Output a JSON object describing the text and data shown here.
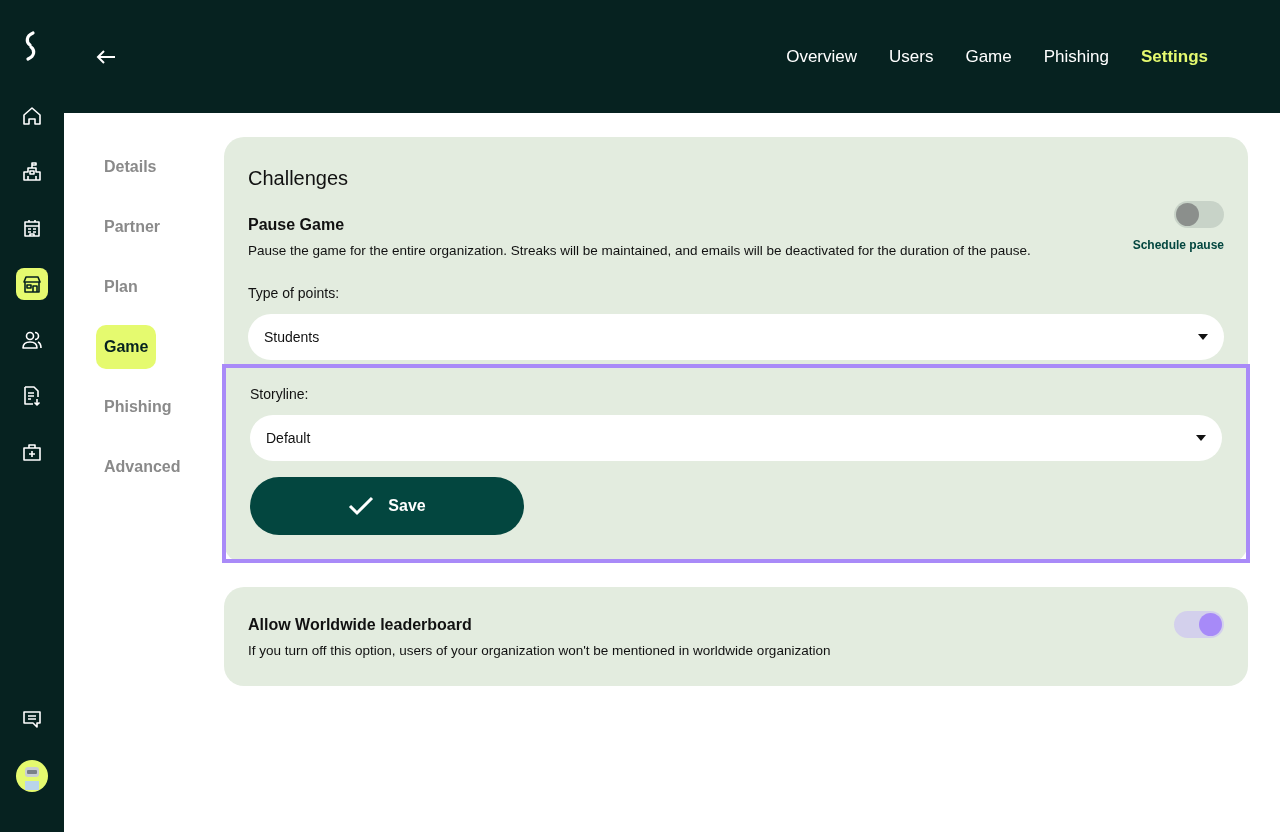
{
  "rail": {
    "items": [
      {
        "kind": "home",
        "selected": false
      },
      {
        "kind": "school",
        "selected": false
      },
      {
        "kind": "building",
        "selected": false
      },
      {
        "kind": "store",
        "selected": true
      },
      {
        "kind": "users",
        "selected": false
      },
      {
        "kind": "report",
        "selected": false
      },
      {
        "kind": "medkit",
        "selected": false
      }
    ],
    "bottom": [
      {
        "kind": "chat"
      },
      {
        "kind": "avatar"
      }
    ]
  },
  "top_nav": {
    "tabs": [
      {
        "label": "Overview",
        "selected": false
      },
      {
        "label": "Users",
        "selected": false
      },
      {
        "label": "Game",
        "selected": false
      },
      {
        "label": "Phishing",
        "selected": false
      },
      {
        "label": "Settings",
        "selected": true
      }
    ]
  },
  "settings_menu": {
    "items": [
      {
        "label": "Details",
        "selected": false
      },
      {
        "label": "Partner",
        "selected": false
      },
      {
        "label": "Plan",
        "selected": false
      },
      {
        "label": "Game",
        "selected": true
      },
      {
        "label": "Phishing",
        "selected": false
      },
      {
        "label": "Advanced",
        "selected": false
      }
    ]
  },
  "challenges": {
    "title": "Challenges",
    "pause_game": {
      "title": "Pause Game",
      "description": "Pause the game for the entire organization. Streaks will be maintained, and emails will be deactivated for the duration of the pause.",
      "on": false,
      "schedule_label": "Schedule pause"
    },
    "points": {
      "label": "Type of points:",
      "value": "Students"
    },
    "storyline": {
      "label": "Storyline:",
      "value": "Default",
      "highlighted": true
    },
    "save_button": {
      "label": "Save"
    }
  },
  "leaderboard": {
    "title": "Allow Worldwide leaderboard",
    "description": "If you turn off this option, users of your organization won't be mentioned in worldwide organization",
    "on": true
  }
}
